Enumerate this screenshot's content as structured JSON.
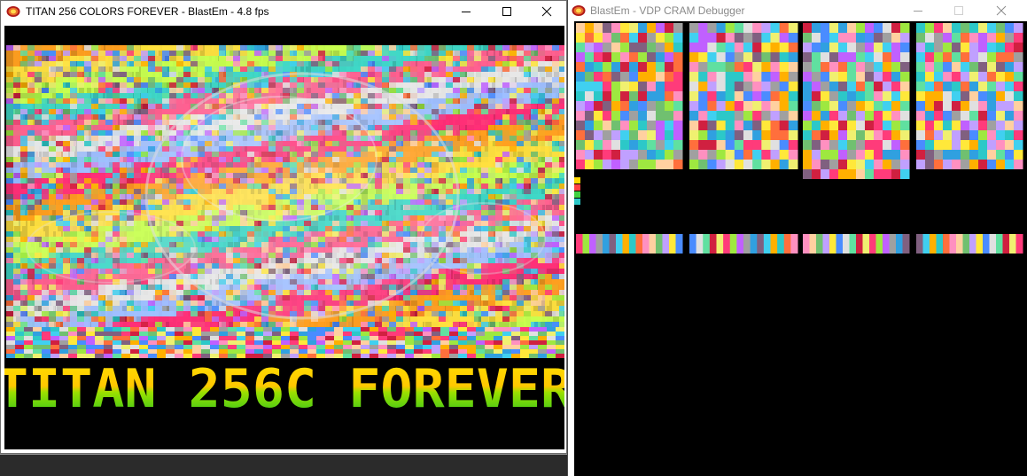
{
  "main_window": {
    "title": "TITAN 256 COLORS FOREVER - BlastEm - 4.8 fps",
    "banner_text": "TITAN 256C FOREVER",
    "controls": [
      "minimize-icon",
      "maximize-icon",
      "close-icon"
    ]
  },
  "cram_window": {
    "title": "BlastEm - VDP CRAM Debugger",
    "controls": [
      "minimize-icon",
      "maximize-icon",
      "close-icon"
    ]
  },
  "colors": {
    "icon_orange": "#e8702a",
    "icon_red": "#b01818",
    "icon_yellow": "#ffd84a",
    "banner_yellow": "#ffd800",
    "banner_green": "#24c820"
  }
}
